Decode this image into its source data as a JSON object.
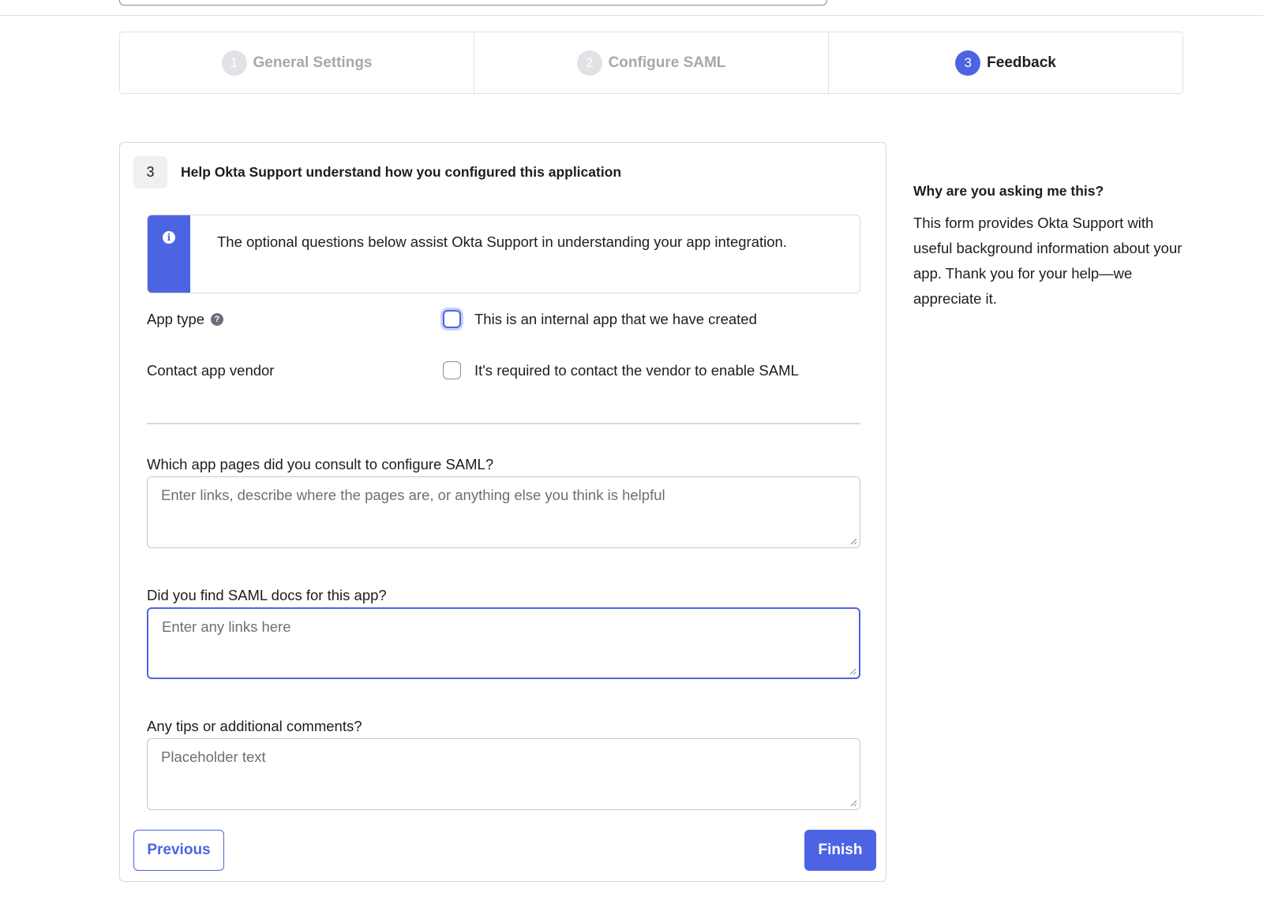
{
  "stepper": {
    "steps": [
      {
        "number": "1",
        "label": "General Settings",
        "state": "completed"
      },
      {
        "number": "2",
        "label": "Configure SAML",
        "state": "completed"
      },
      {
        "number": "3",
        "label": "Feedback",
        "state": "active"
      }
    ]
  },
  "card": {
    "step_badge": "3",
    "title": "Help Okta Support understand how you configured this application",
    "callout": {
      "icon": "info-icon",
      "text": "The optional questions below assist Okta Support in understanding your app integration."
    },
    "app_type": {
      "label": "App type",
      "checkbox_label": "This is an internal app that we have created",
      "checked": false
    },
    "contact_vendor": {
      "label": "Contact app vendor",
      "checkbox_label": "It's required to contact the vendor to enable SAML",
      "checked": false
    },
    "fields": [
      {
        "label": "Which app pages did you consult to configure SAML?",
        "placeholder": "Enter links, describe where the pages are, or anything else you think is helpful",
        "value": ""
      },
      {
        "label": "Did you find SAML docs for this app?",
        "placeholder": "Enter any links here",
        "value": ""
      },
      {
        "label": "Any tips or additional comments?",
        "placeholder": "Placeholder text",
        "value": ""
      }
    ],
    "buttons": {
      "previous": "Previous",
      "finish": "Finish"
    }
  },
  "side": {
    "heading": "Why are you asking me this?",
    "body": "This form provides Okta Support with useful background information about your app. Thank you for your help—we appreciate it."
  },
  "colors": {
    "accent": "#4c64e3",
    "border": "#d7d7dc",
    "muted_text": "#a7a7ae"
  }
}
